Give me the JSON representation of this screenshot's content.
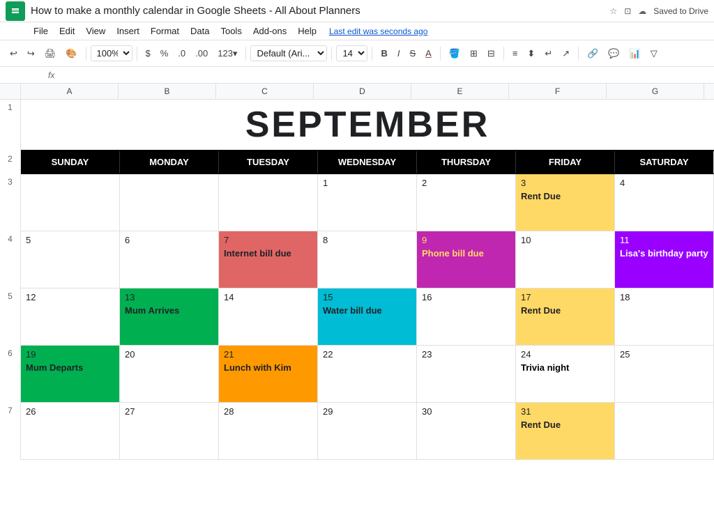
{
  "titleBar": {
    "logo": "G",
    "title": "How to make a monthly calendar in Google Sheets - All About Planners",
    "savedLabel": "Saved to Drive"
  },
  "menuBar": {
    "items": [
      "File",
      "Edit",
      "View",
      "Insert",
      "Format",
      "Data",
      "Tools",
      "Add-ons",
      "Help"
    ],
    "lastEdit": "Last edit was seconds ago"
  },
  "toolbar": {
    "zoom": "100%",
    "currency": "$",
    "percent": "%",
    "decimal0": ".0",
    "decimal00": ".00",
    "format123": "123▾",
    "font": "Default (Ari...  ▾",
    "fontSize": "14  ▾",
    "bold": "B",
    "italic": "I",
    "strikethrough": "S̶",
    "underline": "A"
  },
  "colHeaders": [
    "A",
    "B",
    "C",
    "D",
    "E",
    "F",
    "G"
  ],
  "rowNums": [
    "1",
    "2",
    "3",
    "4",
    "5",
    "6",
    "7"
  ],
  "calendar": {
    "title": "SEPTEMBER",
    "dayHeaders": [
      "SUNDAY",
      "MONDAY",
      "TUESDAY",
      "WEDNESDAY",
      "THURSDAY",
      "FRIDAY",
      "SATURDAY"
    ],
    "weeks": [
      {
        "rowNum": "3",
        "cells": [
          {
            "date": "",
            "event": "",
            "bg": "",
            "textColor": ""
          },
          {
            "date": "",
            "event": "",
            "bg": "",
            "textColor": ""
          },
          {
            "date": "",
            "event": "",
            "bg": "",
            "textColor": ""
          },
          {
            "date": "1",
            "event": "",
            "bg": "",
            "textColor": ""
          },
          {
            "date": "2",
            "event": "",
            "bg": "",
            "textColor": ""
          },
          {
            "date": "3",
            "event": "Rent Due",
            "bg": "bg-yellow",
            "textColor": "text-black"
          },
          {
            "date": "4",
            "event": "",
            "bg": "",
            "textColor": ""
          }
        ]
      },
      {
        "rowNum": "4",
        "cells": [
          {
            "date": "5",
            "event": "",
            "bg": "",
            "textColor": ""
          },
          {
            "date": "6",
            "event": "",
            "bg": "",
            "textColor": ""
          },
          {
            "date": "7",
            "event": "Internet bill due",
            "bg": "bg-red",
            "textColor": "text-black"
          },
          {
            "date": "8",
            "event": "",
            "bg": "",
            "textColor": ""
          },
          {
            "date": "9",
            "event": "Phone bill due",
            "bg": "bg-magenta",
            "textColor": "text-yellow"
          },
          {
            "date": "10",
            "event": "",
            "bg": "",
            "textColor": ""
          },
          {
            "date": "11",
            "event": "Lisa's birthday party",
            "bg": "bg-purple",
            "textColor": "text-white"
          }
        ]
      },
      {
        "rowNum": "5",
        "cells": [
          {
            "date": "12",
            "event": "",
            "bg": "",
            "textColor": ""
          },
          {
            "date": "13",
            "event": "Mum Arrives",
            "bg": "bg-green",
            "textColor": "text-black"
          },
          {
            "date": "14",
            "event": "",
            "bg": "",
            "textColor": ""
          },
          {
            "date": "15",
            "event": "Water bill due",
            "bg": "bg-cyan",
            "textColor": "text-black"
          },
          {
            "date": "16",
            "event": "",
            "bg": "",
            "textColor": ""
          },
          {
            "date": "17",
            "event": "Rent Due",
            "bg": "bg-yellow",
            "textColor": "text-black"
          },
          {
            "date": "18",
            "event": "",
            "bg": "",
            "textColor": ""
          }
        ]
      },
      {
        "rowNum": "6",
        "cells": [
          {
            "date": "19",
            "event": "Mum Departs",
            "bg": "bg-lime",
            "textColor": "text-black"
          },
          {
            "date": "20",
            "event": "",
            "bg": "",
            "textColor": ""
          },
          {
            "date": "21",
            "event": "Lunch with Kim",
            "bg": "bg-orange",
            "textColor": "text-black"
          },
          {
            "date": "22",
            "event": "",
            "bg": "",
            "textColor": ""
          },
          {
            "date": "23",
            "event": "",
            "bg": "",
            "textColor": ""
          },
          {
            "date": "24",
            "event": "Trivia night",
            "bg": "",
            "textColor": ""
          },
          {
            "date": "25",
            "event": "",
            "bg": "",
            "textColor": ""
          }
        ]
      },
      {
        "rowNum": "7",
        "cells": [
          {
            "date": "26",
            "event": "",
            "bg": "",
            "textColor": ""
          },
          {
            "date": "27",
            "event": "",
            "bg": "",
            "textColor": ""
          },
          {
            "date": "28",
            "event": "",
            "bg": "",
            "textColor": ""
          },
          {
            "date": "29",
            "event": "",
            "bg": "",
            "textColor": ""
          },
          {
            "date": "30",
            "event": "",
            "bg": "",
            "textColor": ""
          },
          {
            "date": "31",
            "event": "Rent Due",
            "bg": "bg-yellow",
            "textColor": "text-black"
          },
          {
            "date": "",
            "event": "",
            "bg": "",
            "textColor": ""
          }
        ]
      }
    ]
  }
}
